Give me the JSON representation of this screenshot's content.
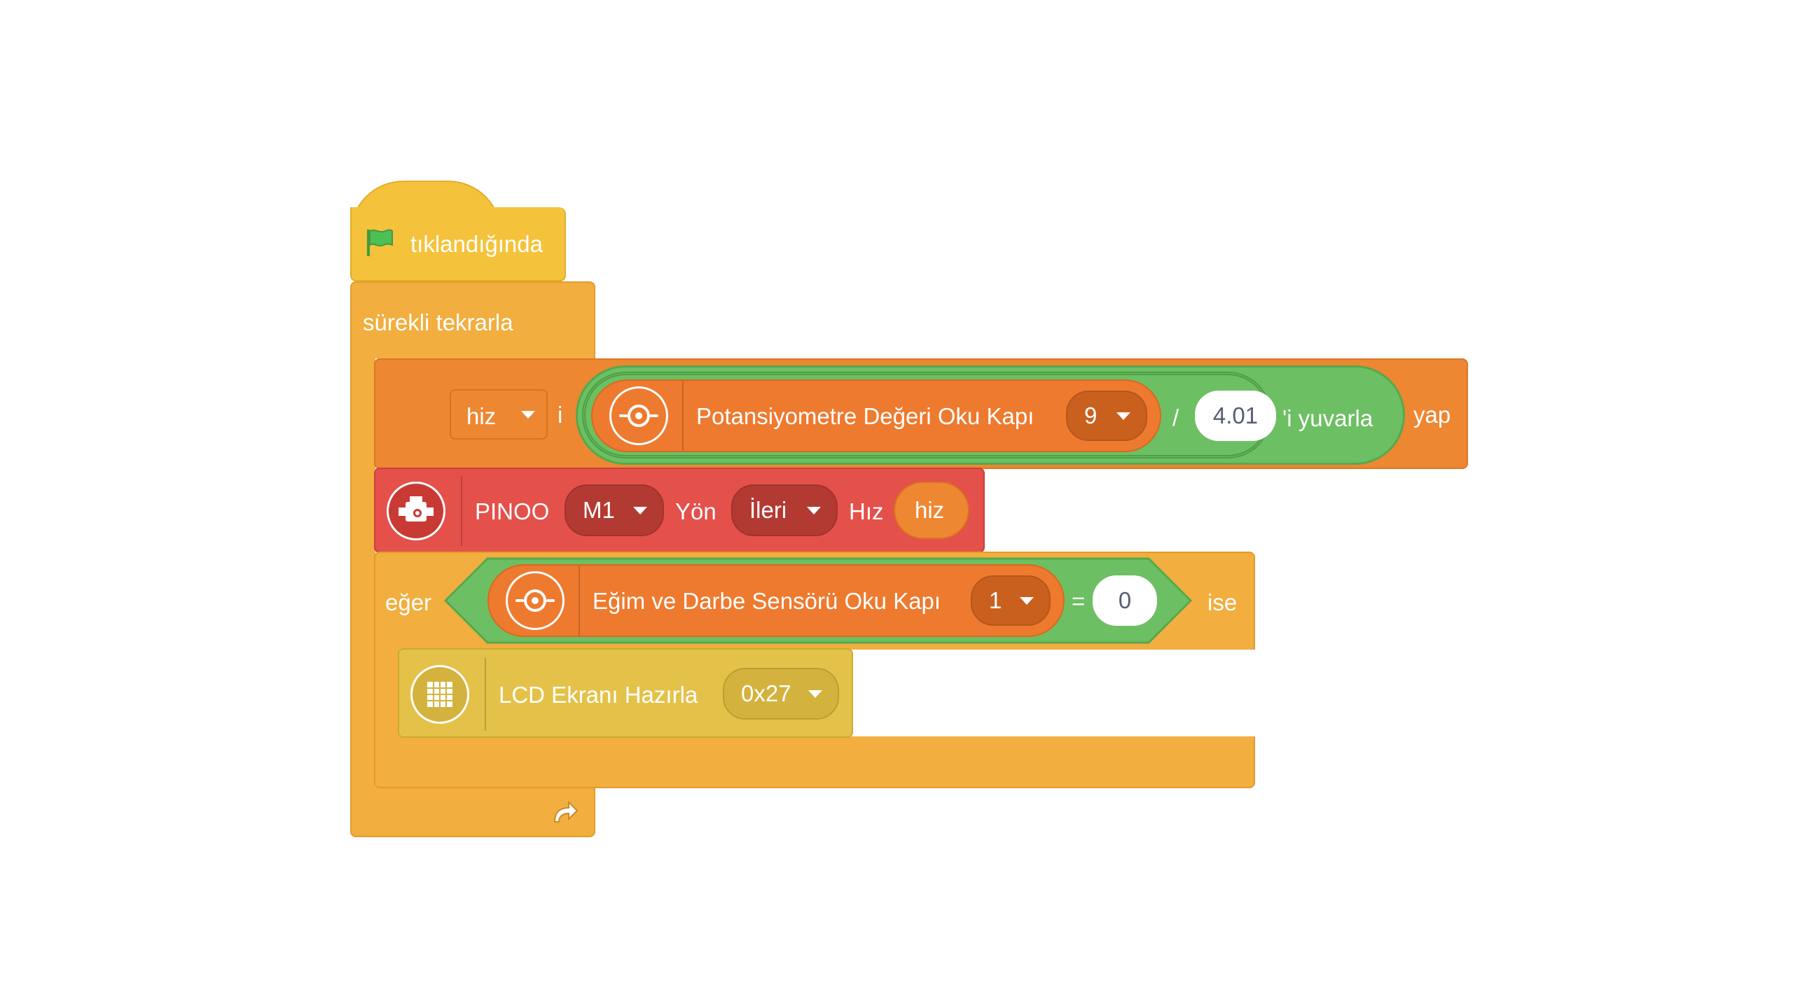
{
  "colors": {
    "events": "#F5C33B",
    "control": "#F2AE3E",
    "variables": "#EE8732",
    "operators": "#6DBF63",
    "motor": "#E4504A",
    "lcd": "#E4C24A"
  },
  "hat": {
    "label": "tıklandığında",
    "icon": "green-flag-icon"
  },
  "forever": {
    "label": "sürekli tekrarla",
    "icon": "loop-arrow-icon"
  },
  "set_var": {
    "variable": "hiz",
    "i_label": "i",
    "make_label": "yap",
    "round": {
      "suffix": "'i yuvarla",
      "divide": {
        "operator": "/",
        "divisor": "4.01",
        "sensor": {
          "label": "Potansiyometre Değeri Oku Kapı",
          "port": "9",
          "icon": "sensor-icon"
        }
      }
    }
  },
  "motor": {
    "icon": "motor-icon",
    "label": "PINOO",
    "motor_value": "M1",
    "direction_label": "Yön",
    "direction_value": "İleri",
    "speed_label": "Hız",
    "speed_value": "hiz"
  },
  "if_block": {
    "if_label": "eğer",
    "then_label": "ise",
    "condition": {
      "operator": "=",
      "value": "0",
      "sensor": {
        "label": "Eğim ve Darbe Sensörü Oku Kapı",
        "port": "1",
        "icon": "sensor-icon"
      }
    }
  },
  "lcd": {
    "icon": "lcd-grid-icon",
    "label": "LCD Ekranı Hazırla",
    "address": "0x27"
  }
}
